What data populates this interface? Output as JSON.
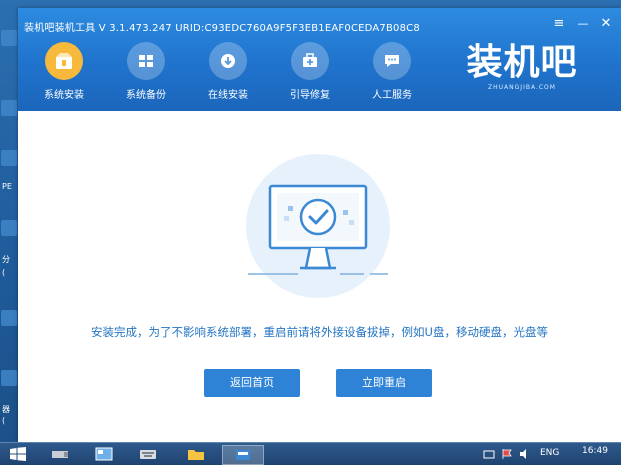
{
  "window": {
    "title": "装机吧装机工具 V 3.1.473.247 URID:C93EDC760A9F5F3EB1EAF0CEDA7B08C8",
    "controls": {
      "menu": "≡",
      "minimize": "—",
      "close": "✕"
    }
  },
  "nav": {
    "items": [
      {
        "label": "系统安装",
        "icon": "install-icon",
        "active": true
      },
      {
        "label": "系统备份",
        "icon": "backup-icon",
        "active": false
      },
      {
        "label": "在线安装",
        "icon": "download-icon",
        "active": false
      },
      {
        "label": "引导修复",
        "icon": "repair-icon",
        "active": false
      },
      {
        "label": "人工服务",
        "icon": "chat-icon",
        "active": false
      }
    ]
  },
  "logo": {
    "main": "装机吧",
    "sub": "ZHUANGJIBA.COM"
  },
  "content": {
    "message": "安装完成，为了不影响系统部署，重启前请将外接设备拔掉，例如U盘，移动硬盘，光盘等",
    "back_button": "返回首页",
    "restart_button": "立即重启"
  },
  "desktop": {
    "labels": [
      "PE",
      "分",
      "(",
      "器",
      "("
    ]
  },
  "taskbar": {
    "language": "ENG",
    "time": "16:49"
  },
  "colors": {
    "header": "#2073cc",
    "accent": "#2f83d7",
    "active_nav": "#f6b93b",
    "message_text": "#2475c4"
  }
}
